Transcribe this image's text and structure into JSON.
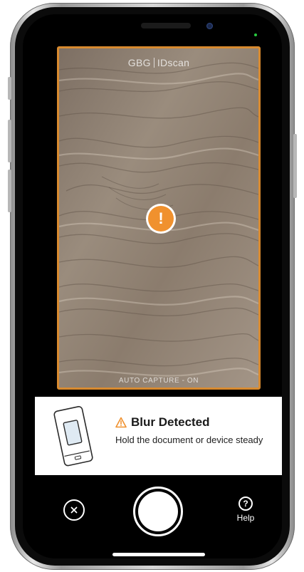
{
  "viewfinder": {
    "brand_left": "GBG",
    "brand_right": "IDscan",
    "alert_glyph": "!",
    "auto_capture": "AUTO CAPTURE - ON",
    "frame_color": "#d88a2f",
    "alert_color": "#f0912e"
  },
  "message": {
    "title": "Blur Detected",
    "body": "Hold the document or device steady",
    "icon": "warning-triangle-icon",
    "warning_color": "#f0912e"
  },
  "controls": {
    "close_icon": "close-icon",
    "shutter": "shutter-button",
    "help_glyph": "?",
    "help_label": "Help"
  }
}
